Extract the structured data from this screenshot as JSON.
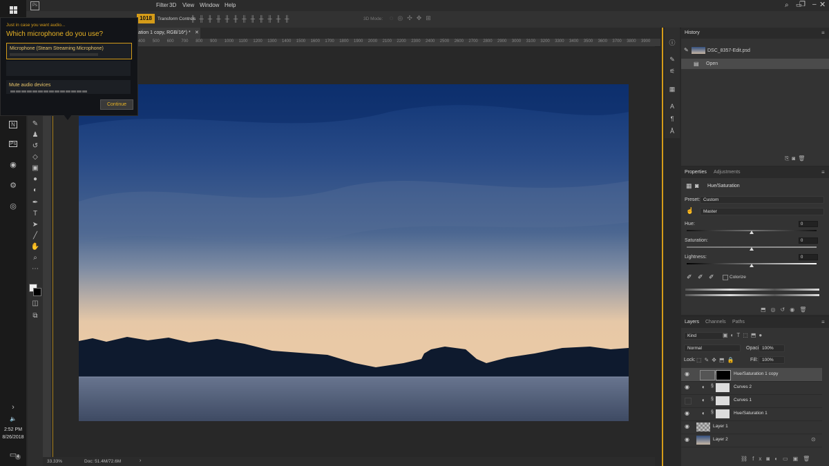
{
  "menubar": {
    "items": [
      "Filter",
      "View",
      "3D",
      "Window",
      "Help"
    ],
    "workspace_label": "Transform Controls",
    "mode_label": "3D Mode:",
    "badge": "1018"
  },
  "popup": {
    "hint": "Just in case you want audio...",
    "title": "Which microphone do you use?",
    "mic_option": "Microphone (Steam Streaming Microphone)",
    "mute_label": "Mute audio devices",
    "continue_label": "Continue"
  },
  "document": {
    "tab_title": "ation 1 copy, RGB/16*) *",
    "ruler_marks": [
      "400",
      "500",
      "600",
      "700",
      "800",
      "900",
      "1000",
      "1100",
      "1200",
      "1300",
      "1400",
      "1500",
      "1600",
      "1700",
      "1800",
      "1900",
      "2000",
      "2100",
      "2200",
      "2300",
      "2400",
      "2500",
      "2600",
      "2700",
      "2800",
      "2900",
      "3000",
      "3100",
      "3200",
      "3300",
      "3400",
      "3500",
      "3600",
      "3700",
      "3800",
      "3900"
    ],
    "zoom": "33.33%",
    "doc_size": "Doc: 51.4M/72.6M"
  },
  "history": {
    "title": "History",
    "file": "DSC_8357-Edit.psd",
    "state": "Open"
  },
  "properties": {
    "tabs": [
      "Properties",
      "Adjustments"
    ],
    "adjustment": "Hue/Saturation",
    "preset_label": "Preset:",
    "preset_value": "Custom",
    "channel": "Master",
    "hue_label": "Hue:",
    "hue_value": "0",
    "hue_level": 0.5,
    "saturation_label": "Saturation:",
    "saturation_value": "0",
    "saturation_level": 0.5,
    "lightness_label": "Lightness:",
    "lightness_value": "0",
    "lightness_level": 0.5,
    "colorize_label": "Colorize"
  },
  "layers": {
    "tabs": [
      "Layers",
      "Channels",
      "Paths"
    ],
    "filter_kind": "Kind",
    "blend_mode": "Normal",
    "opacity_label": "Opacity:",
    "opacity_value": "100%",
    "lock_label": "Lock:",
    "fill_label": "Fill:",
    "fill_value": "100%",
    "items": [
      {
        "name": "Hue/Saturation 1 copy"
      },
      {
        "name": "Curves 2"
      },
      {
        "name": "Curves 1"
      },
      {
        "name": "Hue/Saturation 1"
      },
      {
        "name": "Layer 1"
      },
      {
        "name": "Layer 2"
      }
    ]
  },
  "taskbar": {
    "time": "2:52 PM",
    "date": "8/26/2018",
    "notif_count": "4"
  },
  "colors": {
    "accent": "#d59c19",
    "popup_title": "#e8b325",
    "panel_bg": "#333333",
    "selected_layer": "#4b4b4b"
  }
}
